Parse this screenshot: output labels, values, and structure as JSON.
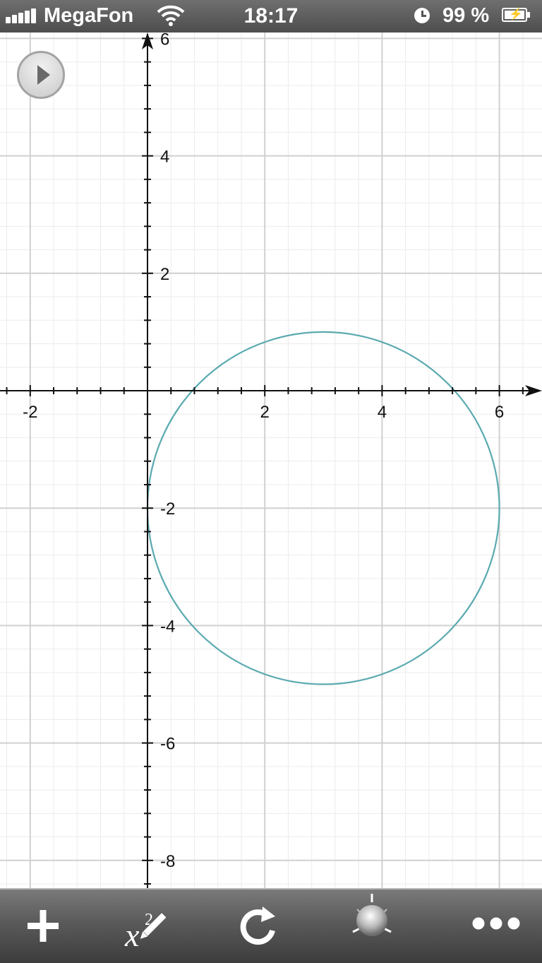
{
  "status_bar": {
    "carrier": "MegaFon",
    "time": "18:17",
    "battery": "99 %"
  },
  "icons": {
    "play": "play-icon",
    "add": "plus-icon",
    "edit_function": "function-pencil-icon",
    "refresh": "refresh-icon",
    "light": "light-bulb-icon",
    "more": "ellipsis-icon"
  },
  "colors": {
    "curve": "#5aaab0",
    "axis": "#111111",
    "grid_major": "#d0d0d0",
    "grid_minor": "#ececec"
  },
  "chart_data": {
    "type": "line",
    "title": "",
    "xlabel": "",
    "ylabel": "",
    "xlim": [
      -2.5,
      6.7
    ],
    "ylim": [
      -8.5,
      6.2
    ],
    "x_ticks": [
      -2,
      2,
      4,
      6
    ],
    "y_ticks": [
      6,
      4,
      2,
      -2,
      -4,
      -6,
      -8
    ],
    "x_tick_labels": [
      "-2",
      "2",
      "4",
      "6"
    ],
    "y_tick_labels": [
      "6",
      "4",
      "2",
      "-2",
      "-4",
      "-6",
      "-8"
    ],
    "grid": true,
    "series": [
      {
        "shape": "circle",
        "center": [
          3,
          -2
        ],
        "radius": 3,
        "color": "#5aaab0"
      }
    ]
  }
}
